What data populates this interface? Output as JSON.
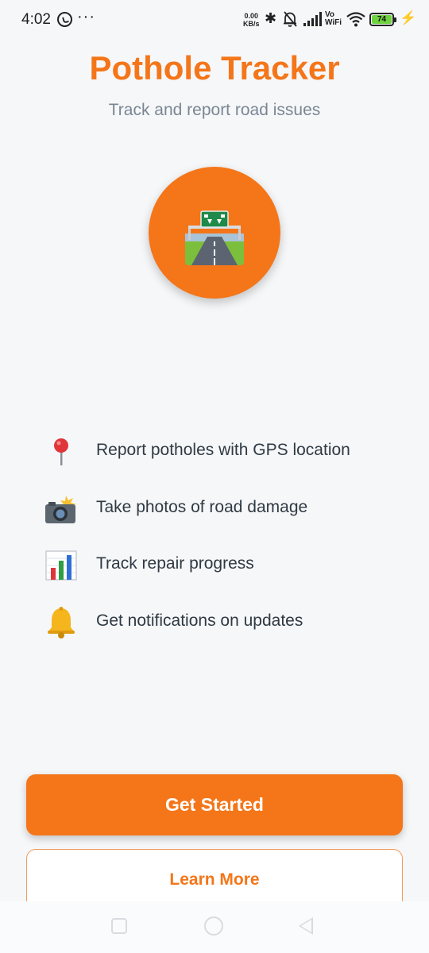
{
  "status_bar": {
    "time": "4:02",
    "speed_value": "0.00",
    "speed_unit": "KB/s",
    "vo_label": "Vo",
    "wifi_label": "WiFi",
    "battery_level": "74",
    "icons": [
      "whatsapp-icon",
      "more-dots-icon",
      "bluetooth-icon",
      "mute-bell-icon",
      "signal-icon",
      "wifi-icon",
      "battery-icon",
      "charging-icon"
    ]
  },
  "app": {
    "title": "Pothole Tracker",
    "subtitle": "Track and report road issues",
    "hero_icon": "motorway-icon"
  },
  "features": [
    {
      "icon": "pin-icon",
      "text": "Report potholes with GPS location"
    },
    {
      "icon": "camera-flash-icon",
      "text": "Take photos of road damage"
    },
    {
      "icon": "bar-chart-icon",
      "text": "Track repair progress"
    },
    {
      "icon": "bell-icon",
      "text": "Get notifications on updates"
    }
  ],
  "buttons": {
    "get_started": "Get Started",
    "learn_more": "Learn More"
  },
  "nav_bar": {
    "icons": [
      "recent-apps-icon",
      "home-icon",
      "back-icon"
    ]
  },
  "colors": {
    "accent": "#f47619",
    "background": "#f6f7f9",
    "subtitle": "#7a8793",
    "text": "#2f3a43"
  }
}
